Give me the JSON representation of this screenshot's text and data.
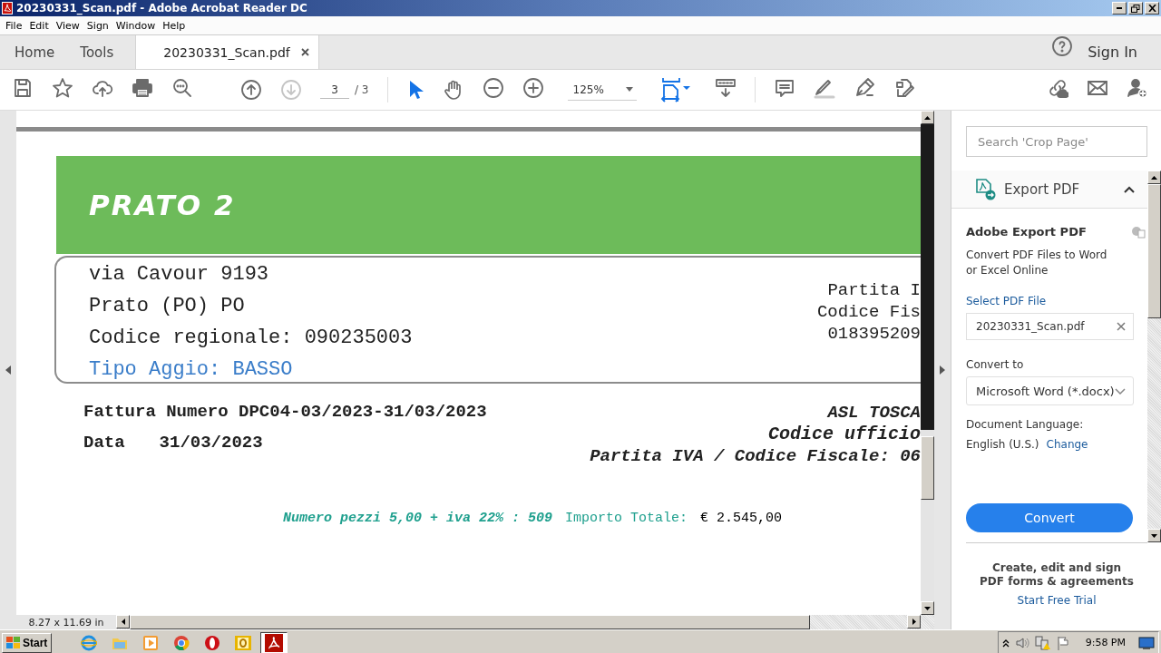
{
  "window": {
    "title": "20230331_Scan.pdf - Adobe Acrobat Reader DC"
  },
  "menu": [
    "File",
    "Edit",
    "View",
    "Sign",
    "Window",
    "Help"
  ],
  "tabs": [
    {
      "label": "Home",
      "selected": false
    },
    {
      "label": "Tools",
      "selected": false
    },
    {
      "label": "20230331_Scan.pdf",
      "selected": true,
      "closable": true
    }
  ],
  "sign_in": "Sign In",
  "toolbar": {
    "nav": [
      {
        "kind": "prev",
        "disabled": false
      },
      {
        "kind": "next",
        "disabled": true
      }
    ],
    "page_field": {
      "value": "3"
    },
    "page_total": "/ 3",
    "tools": [
      {
        "kind": "select",
        "selected": true
      },
      {
        "kind": "hand",
        "selected": false
      }
    ],
    "zoom": {
      "value": "125%"
    }
  },
  "document": {
    "banner": "PRATO 2",
    "address_lines": [
      "via Cavour 9193",
      "Prato (PO) PO",
      "Codice regionale: 090235003"
    ],
    "tipo_aggio": "Tipo Aggio: BASSO",
    "right_lines": [
      "Partita I",
      "Codice Fis",
      "018395209"
    ],
    "invoice_number": "Fattura Numero DPC04-03/2023-31/03/2023",
    "date_label": "Data",
    "date": "31/03/2023",
    "recipient": [
      "ASL TOSCA",
      "Codice ufficio",
      "Partita IVA / Codice Fiscale: 06"
    ],
    "pieces": "Numero pezzi 5,00 + iva 22% : 509",
    "total_label": "Importo Totale:",
    "total": "€ 2.545,00"
  },
  "page_size": "8.27 x 11.69 in",
  "panel": {
    "search": {
      "placeholder": "Search 'Crop Page'"
    },
    "export": {
      "title": "Export PDF",
      "expanded": true,
      "heading": "Adobe Export PDF",
      "description": "Convert PDF Files to Word or Excel Online",
      "select_link": "Select PDF File",
      "file": {
        "value": "20230331_Scan.pdf"
      },
      "convert_to_label": "Convert to",
      "format": {
        "value": "Microsoft Word (*.docx)"
      },
      "language_label": "Document Language:",
      "language": "English (U.S.)",
      "change_link": "Change",
      "convert_button": "Convert"
    },
    "promo": {
      "text": "Create, edit and sign PDF forms & agreements",
      "link": "Start Free Trial"
    }
  },
  "taskbar": {
    "start": "Start",
    "apps": [
      {
        "kind": "ie",
        "selected": false
      },
      {
        "kind": "folder",
        "selected": false
      },
      {
        "kind": "media",
        "selected": false
      },
      {
        "kind": "chrome",
        "selected": false
      },
      {
        "kind": "opera",
        "selected": false
      },
      {
        "kind": "outlook",
        "selected": false
      },
      {
        "kind": "acrobat",
        "selected": true
      }
    ],
    "clock": "9:58 PM"
  }
}
